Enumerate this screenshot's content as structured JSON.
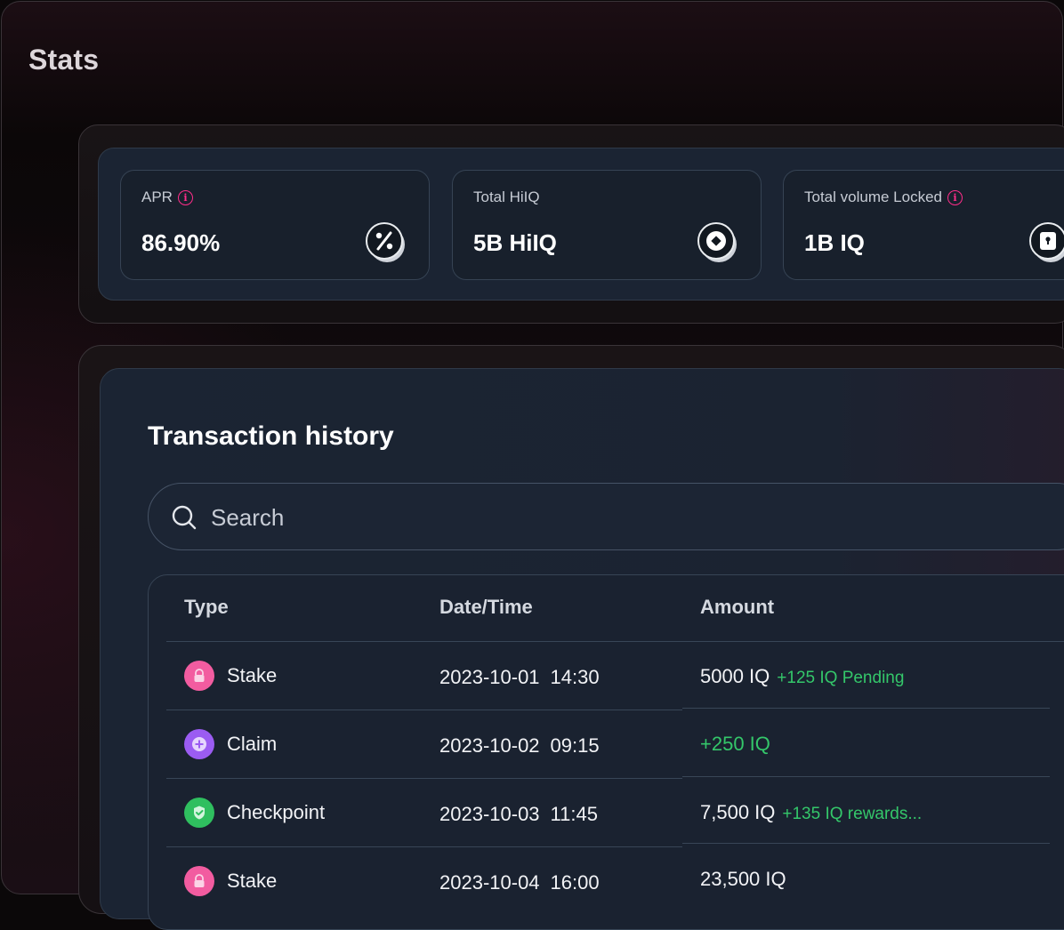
{
  "page": {
    "title": "Stats"
  },
  "stats": [
    {
      "label": "APR",
      "value": "86.90%",
      "has_info": true,
      "icon": "percent-icon"
    },
    {
      "label": "Total HiIQ",
      "value": "5B HiIQ",
      "has_info": false,
      "icon": "coin-icon"
    },
    {
      "label": "Total volume Locked",
      "value": "1B IQ",
      "has_info": true,
      "icon": "lock-icon"
    }
  ],
  "transactions": {
    "title": "Transaction history",
    "search": {
      "placeholder": "Search",
      "value": ""
    },
    "columns": [
      "Type",
      "Date/Time",
      "Amount"
    ],
    "rows": [
      {
        "type": "Stake",
        "icon": "lock-icon",
        "icon_color": "#f25ca0",
        "date": "2023-10-01",
        "time": "14:30",
        "amount": "5000 IQ",
        "amount_sub": "+125 IQ Pending",
        "amount_is_green": false
      },
      {
        "type": "Claim",
        "icon": "plus-icon",
        "icon_color": "#9b5cf2",
        "date": "2023-10-02",
        "time": "09:15",
        "amount": "+250 IQ",
        "amount_sub": "",
        "amount_is_green": true
      },
      {
        "type": "Checkpoint",
        "icon": "shield-check-icon",
        "icon_color": "#2fbf5f",
        "date": "2023-10-03",
        "time": "11:45",
        "amount": "7,500 IQ",
        "amount_sub": "+135 IQ rewards...",
        "amount_is_green": false
      },
      {
        "type": "Stake",
        "icon": "lock-icon",
        "icon_color": "#f25ca0",
        "date": "2023-10-04",
        "time": "16:00",
        "amount": "23,500 IQ",
        "amount_sub": "",
        "amount_is_green": false
      }
    ]
  },
  "colors": {
    "accent_pink": "#ff2d8a",
    "positive_green": "#34c76a"
  }
}
